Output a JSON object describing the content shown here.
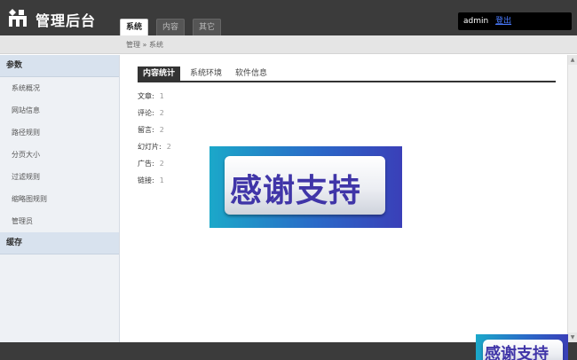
{
  "header": {
    "title": "管理后台",
    "tabs": [
      {
        "label": "系统",
        "active": true
      },
      {
        "label": "内容",
        "active": false
      },
      {
        "label": "其它",
        "active": false
      }
    ],
    "user": {
      "name": "admin",
      "logout_label": "登出"
    }
  },
  "breadcrumb": {
    "text": "管理 » 系统"
  },
  "sidebar": {
    "section_params": "参数",
    "items": [
      "系统概况",
      "网站信息",
      "路径规则",
      "分页大小",
      "过滤规则",
      "缩略图规则",
      "管理员"
    ],
    "section_cache": "缓存"
  },
  "content": {
    "tabs": [
      {
        "label": "内容统计",
        "active": true
      },
      {
        "label": "系统环境",
        "active": false
      },
      {
        "label": "软件信息",
        "active": false
      }
    ],
    "stats": [
      {
        "label": "文章:",
        "value": "1"
      },
      {
        "label": "评论:",
        "value": "2"
      },
      {
        "label": "留言:",
        "value": "2"
      },
      {
        "label": "幻灯片:",
        "value": "2"
      },
      {
        "label": "广告:",
        "value": "2"
      },
      {
        "label": "链接:",
        "value": "1"
      }
    ]
  },
  "overlay": {
    "banner_text": "感谢支持",
    "colors": {
      "gradient_start": "#1ba8c9",
      "gradient_end": "#3a3fb8",
      "text": "#4035a8"
    }
  }
}
